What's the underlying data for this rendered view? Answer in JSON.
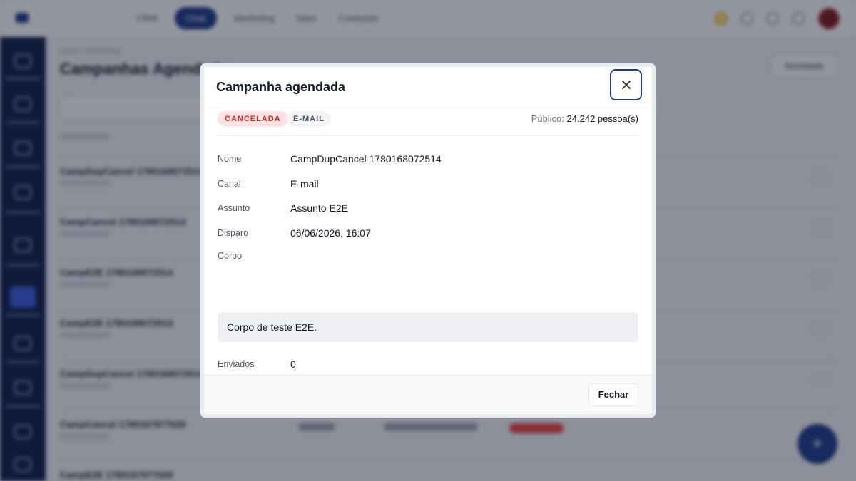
{
  "background": {
    "nav": [
      "CRM",
      "Chat",
      "Marketing",
      "Sites",
      "Conteúdo"
    ],
    "breadcrumb": "Início / Marketing",
    "page_title": "Campanhas Agendadas",
    "new_button": "Novidade",
    "rows": [
      "CampDupCancel 1780168072514",
      "CampCancel 1780168072514",
      "CampE2E 1780168072514",
      "CampE2E 1780168072514",
      "CampDupCancel 1780168072514",
      "CampCancel 1780167977029",
      "CampE2E 1780167977029"
    ],
    "fab": "+"
  },
  "modal": {
    "title": "Campanha agendada",
    "status_badge": "CANCELADA",
    "channel_badge": "E-MAIL",
    "audience_label": "Público:",
    "audience_value": "24.242 pessoa(s)",
    "fields": {
      "name": {
        "label": "Nome",
        "value": "CampDupCancel 1780168072514"
      },
      "channel": {
        "label": "Canal",
        "value": "E-mail"
      },
      "subject": {
        "label": "Assunto",
        "value": "Assunto E2E"
      },
      "send_time": {
        "label": "Disparo",
        "value": "06/06/2026, 16:07"
      },
      "body": {
        "label": "Corpo",
        "value": "Corpo de teste E2E."
      },
      "sent": {
        "label": "Enviados",
        "value": "0"
      }
    },
    "close_button": "Fechar"
  },
  "colors": {
    "accent": "#1e3a8a",
    "status_cancelled_bg": "#fde2e2",
    "status_cancelled_text": "#dc2626"
  },
  "icons": {
    "close": "close-icon"
  }
}
